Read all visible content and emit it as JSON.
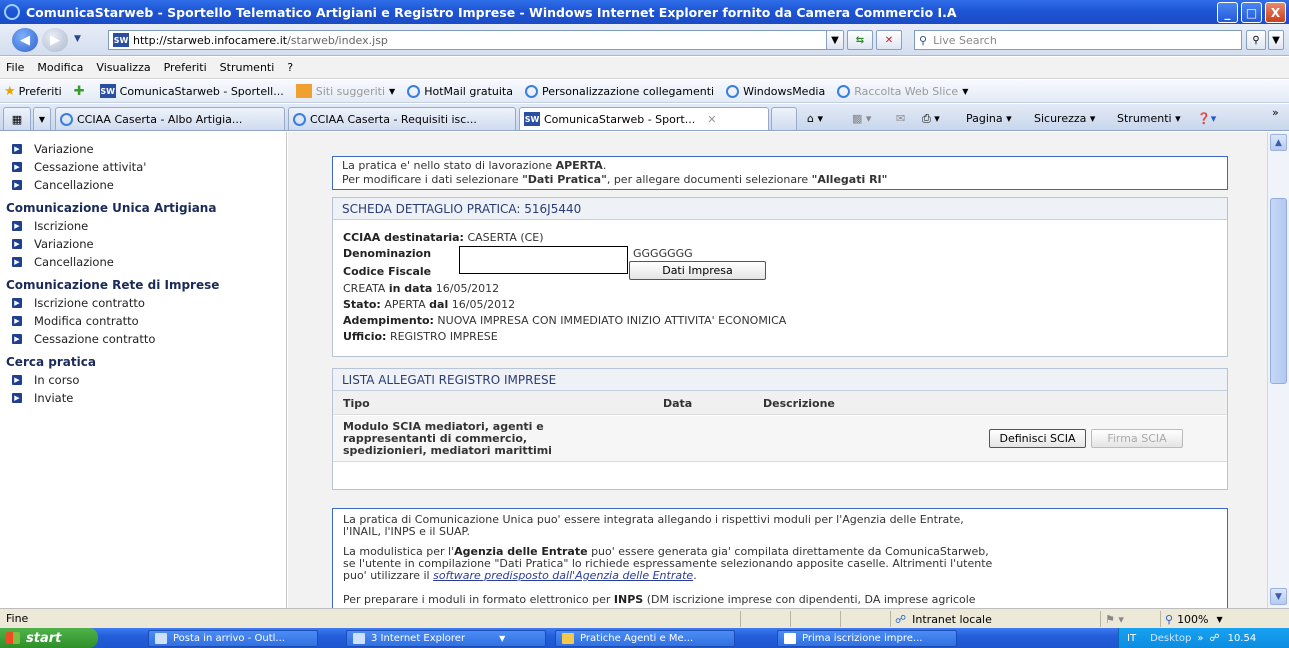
{
  "window": {
    "title": "ComunicaStarweb - Sportello Telematico Artigiani e Registro Imprese - Windows Internet Explorer fornito da Camera Commercio I.A",
    "buttons": {
      "minimize": "_",
      "maximize": "□",
      "close": "X"
    }
  },
  "address": {
    "host": "http://starweb.infocamere.it",
    "path": "/starweb/index.jsp",
    "search_placeholder": "Live Search"
  },
  "menu": [
    "File",
    "Modifica",
    "Visualizza",
    "Preferiti",
    "Strumenti",
    "?"
  ],
  "favorites": {
    "label": "Preferiti",
    "items": [
      {
        "label": "ComunicaStarweb - Sportell...",
        "dim": false
      },
      {
        "label": "Siti suggeriti",
        "dim": true
      },
      {
        "label": "HotMail gratuita",
        "dim": false
      },
      {
        "label": "Personalizzazione collegamenti",
        "dim": false
      },
      {
        "label": "WindowsMedia",
        "dim": false
      },
      {
        "label": "Raccolta Web Slice",
        "dim": true
      }
    ]
  },
  "tabs": [
    {
      "label": "CCIAA Caserta - Albo Artigia..."
    },
    {
      "label": "CCIAA Caserta - Requisiti isc..."
    },
    {
      "label": "ComunicaStarweb - Sport..."
    }
  ],
  "commandbar": {
    "page": "Pagina",
    "safety": "Sicurezza",
    "tools": "Strumenti"
  },
  "sidebar": {
    "top_items": [
      "Variazione",
      "Cessazione attivita'",
      "Cancellazione"
    ],
    "sections": [
      {
        "title": "Comunicazione Unica Artigiana",
        "items": [
          "Iscrizione",
          "Variazione",
          "Cancellazione"
        ]
      },
      {
        "title": "Comunicazione Rete di Imprese",
        "items": [
          "Iscrizione contratto",
          "Modifica contratto",
          "Cessazione contratto"
        ]
      },
      {
        "title": "Cerca pratica",
        "items": [
          "In corso",
          "Inviate"
        ]
      }
    ]
  },
  "info": {
    "line1_pre": "La pratica e' nello stato di lavorazione ",
    "line1_state": "APERTA",
    "line1_post": ".",
    "line2_pre": "Per modificare i dati selezionare ",
    "line2_q1": "\"Dati Pratica\"",
    "line2_mid": ", per allegare documenti selezionare ",
    "line2_q2": "\"Allegati RI\""
  },
  "scheda": {
    "header": "SCHEDA DETTAGLIO PRATICA: 516J5440",
    "cciaa_label": "CCIAA destinataria:",
    "cciaa_value": "CASERTA (CE)",
    "denom_label": "Denominazion",
    "denom_value": "GGGGGGG",
    "cf_label": "Codice Fiscale",
    "dati_impresa_button": "Dati Impresa",
    "creata_label": "CREATA",
    "creata_in_data": "in data",
    "creata_date": "16/05/2012",
    "stato_label": "Stato:",
    "stato_value": "APERTA",
    "stato_dal": "dal",
    "stato_date": "16/05/2012",
    "adempimento_label": "Adempimento:",
    "adempimento_value": "NUOVA IMPRESA CON IMMEDIATO INIZIO ATTIVITA' ECONOMICA",
    "ufficio_label": "Ufficio:",
    "ufficio_value": "REGISTRO IMPRESE"
  },
  "allegati": {
    "header": "LISTA ALLEGATI REGISTRO IMPRESE",
    "columns": [
      "Tipo",
      "Data",
      "Descrizione"
    ],
    "row": {
      "tipo_lines": [
        "Modulo SCIA mediatori, agenti e",
        "rappresentanti di commercio,",
        "spedizionieri, mediatori marittimi"
      ],
      "define_button": "Definisci SCIA",
      "sign_button": "Firma SCIA"
    }
  },
  "notes": {
    "p1a": "La pratica di Comunicazione Unica puo' essere integrata allegando i rispettivi moduli per l'Agenzia delle Entrate,",
    "p1b": "l'INAIL, l'INPS e il SUAP.",
    "p2a_pre": "La modulistica per l'",
    "p2a_bold": "Agenzia delle Entrate",
    "p2a_post": " puo' essere generata gia' compilata direttamente da ComunicaStarweb,",
    "p2b": "se l'utente in compilazione \"Dati Pratica\" lo richiede espressamente selezionando apposite caselle. Altrimenti l'utente",
    "p2c_pre": "puo' utilizzare il ",
    "p2c_link": "software predisposto dall'Agenzia delle Entrate",
    "p2c_post": ".",
    "p3_pre": "Per preparare i moduli in formato elettronico per ",
    "p3_bold": "INPS",
    "p3_post": " (DM iscrizione imprese con dipendenti, DA imprese agricole"
  },
  "status": {
    "left": "Fine",
    "zone": "Intranet locale",
    "zoom": "100%"
  },
  "taskbar": {
    "start": "start",
    "tasks": [
      "Posta in arrivo - Outl...",
      "3 Internet Explorer",
      "Pratiche Agenti e Me...",
      "Prima iscrizione impre..."
    ],
    "lang": "IT",
    "desktop": "Desktop",
    "clock": "10.54"
  }
}
